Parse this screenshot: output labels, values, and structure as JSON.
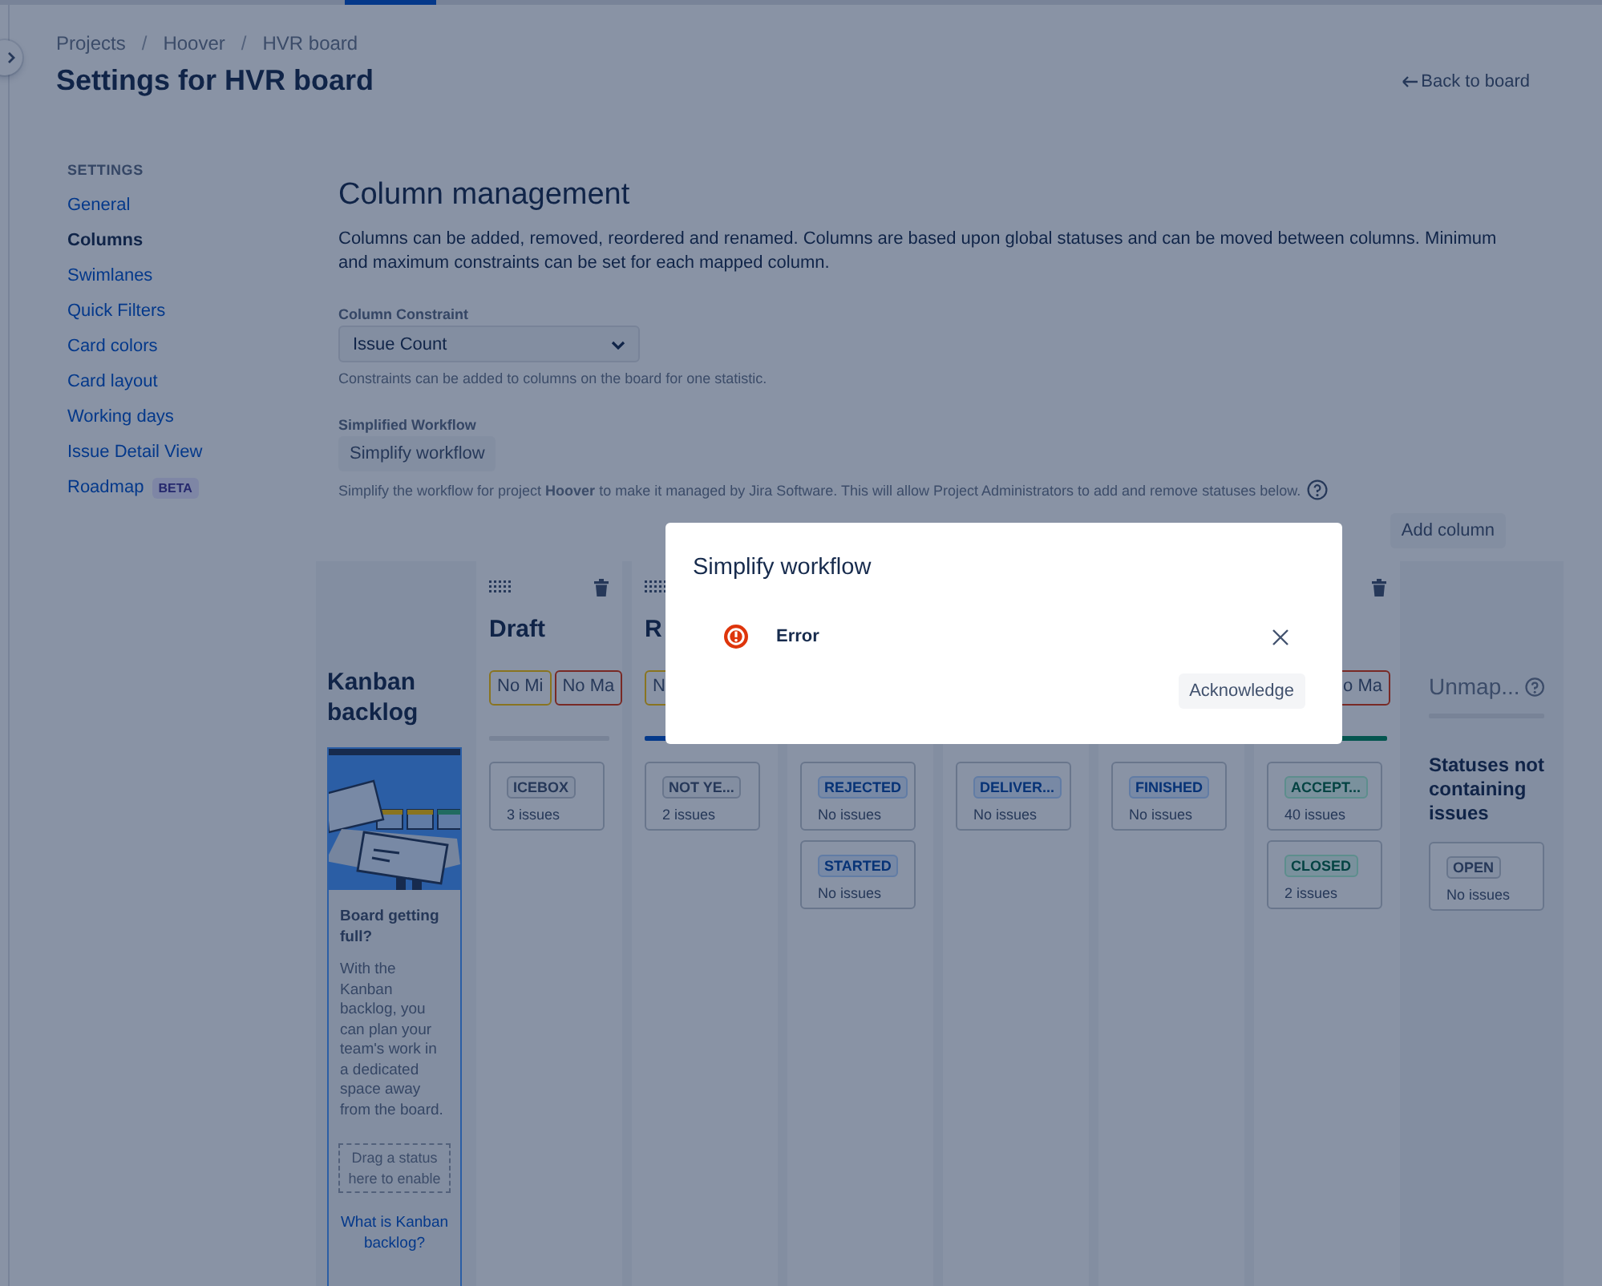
{
  "breadcrumbs": [
    {
      "kind": "link",
      "text": "Projects"
    },
    {
      "kind": "separator",
      "text": "/"
    },
    {
      "kind": "link",
      "text": "Hoover"
    },
    {
      "kind": "separator",
      "text": "/"
    },
    {
      "kind": "link",
      "text": "HVR board"
    }
  ],
  "title": "Settings for HVR board",
  "back_link": "Back to board",
  "sidebar": {
    "heading": "SETTINGS",
    "items": [
      {
        "label": "General",
        "selected": false
      },
      {
        "label": "Columns",
        "selected": true
      },
      {
        "label": "Swimlanes",
        "selected": false
      },
      {
        "label": "Quick Filters",
        "selected": false
      },
      {
        "label": "Card colors",
        "selected": false
      },
      {
        "label": "Card layout",
        "selected": false
      },
      {
        "label": "Working days",
        "selected": false
      },
      {
        "label": "Issue Detail View",
        "selected": false
      },
      {
        "label": "Roadmap",
        "selected": false,
        "badge": "BETA"
      }
    ]
  },
  "main": {
    "heading": "Column management",
    "description": "Columns can be added, removed, reordered and renamed. Columns are based upon global statuses and can be moved between columns. Minimum and maximum constraints can be set for each mapped column.",
    "constraint": {
      "label": "Column Constraint",
      "value": "Issue Count",
      "help": "Constraints can be added to columns on the board for one statistic."
    },
    "workflow": {
      "label": "Simplified Workflow",
      "button": "Simplify workflow",
      "help": "Simplify the workflow for project **Hoover** to make it managed by Jira Software. This will allow Project Administrators to add and remove statuses below."
    },
    "add_column": "Add column"
  },
  "board": {
    "backlog": {
      "title": "Kanban backlog",
      "heading": "Board getting full?",
      "text": "With the Kanban backlog, you can plan your team's work in a dedicated space away from the board.",
      "drop_zone": "Drag a status here to enable",
      "link": "What is Kanban backlog?"
    },
    "columns": [
      {
        "title": "Draft",
        "drag_handle": true,
        "delete": true,
        "min": "No Mi",
        "max": "No Ma",
        "color": "#788397",
        "cards": [
          {
            "status": "ICEBOX",
            "count": "3 issues",
            "kind": "todo"
          }
        ]
      },
      {
        "title": "R",
        "drag_handle": true,
        "min": "N",
        "color": "#04398a",
        "cards": [
          {
            "status": "NOT YE...",
            "count": "2 issues",
            "kind": "todo"
          }
        ]
      },
      {
        "cards": [
          {
            "status": "REJECTED",
            "count": "No issues",
            "kind": "inprogress"
          },
          {
            "status": "STARTED",
            "count": "No issues",
            "kind": "inprogress"
          }
        ]
      },
      {
        "cards": [
          {
            "status": "DELIVER...",
            "count": "No issues",
            "kind": "inprogress"
          }
        ]
      },
      {
        "cards": [
          {
            "status": "FINISHED",
            "count": "No issues",
            "kind": "inprogress"
          }
        ]
      },
      {
        "delete": true,
        "max": "o Ma",
        "color": "#04554f",
        "cards": [
          {
            "status": "ACCEPT...",
            "count": "40 issues",
            "kind": "done"
          },
          {
            "status": "CLOSED",
            "count": "2 issues",
            "kind": "done"
          }
        ]
      }
    ],
    "unmapped": {
      "title": "Unmap...",
      "color": "#788397",
      "heading": "Statuses not containing issues",
      "cards": [
        {
          "status": "OPEN",
          "count": "No issues",
          "kind": "todo"
        }
      ]
    }
  },
  "modal": {
    "title": "Simplify workflow",
    "message": "Error",
    "button": "Acknowledge"
  }
}
